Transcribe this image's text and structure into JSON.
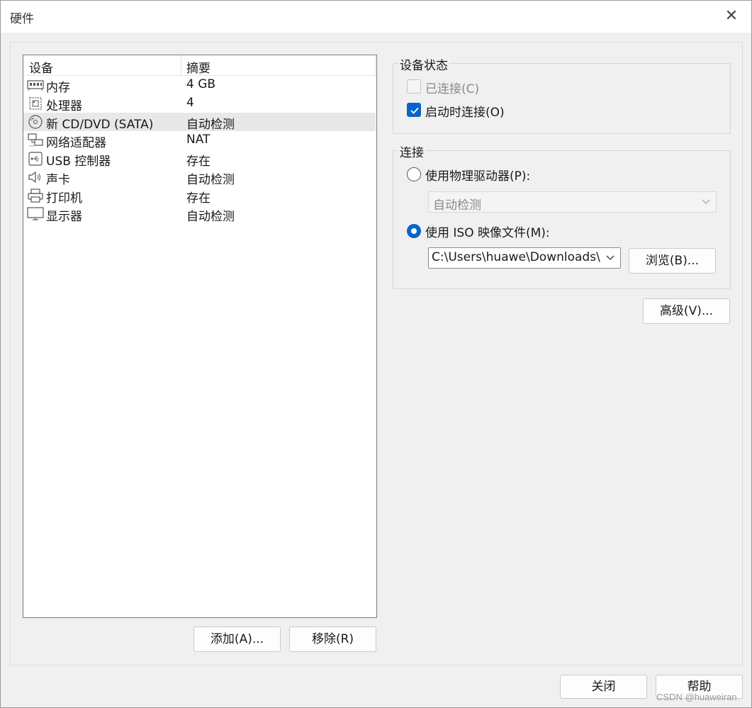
{
  "window": {
    "title": "硬件",
    "close_glyph": "✕"
  },
  "device_list": {
    "headers": {
      "device": "设备",
      "summary": "摘要"
    },
    "rows": [
      {
        "icon": "memory-icon",
        "name": "内存",
        "summary": "4 GB",
        "selected": false
      },
      {
        "icon": "processor-icon",
        "name": "处理器",
        "summary": "4",
        "selected": false
      },
      {
        "icon": "cd-dvd-icon",
        "name": "新 CD/DVD (SATA)",
        "summary": "自动检测",
        "selected": true
      },
      {
        "icon": "network-adapter-icon",
        "name": "网络适配器",
        "summary": "NAT",
        "selected": false
      },
      {
        "icon": "usb-icon",
        "name": "USB 控制器",
        "summary": "存在",
        "selected": false
      },
      {
        "icon": "sound-card-icon",
        "name": "声卡",
        "summary": "自动检测",
        "selected": false
      },
      {
        "icon": "printer-icon",
        "name": "打印机",
        "summary": "存在",
        "selected": false
      },
      {
        "icon": "display-icon",
        "name": "显示器",
        "summary": "自动检测",
        "selected": false
      }
    ],
    "add_button": "添加(A)...",
    "remove_button": "移除(R)"
  },
  "device_status": {
    "title": "设备状态",
    "connected_label": "已连接(C)",
    "connected_checked": false,
    "connected_enabled": false,
    "connect_at_power_on_label": "启动时连接(O)",
    "connect_at_power_on_checked": true
  },
  "connection": {
    "title": "连接",
    "physical_drive_label": "使用物理驱动器(P):",
    "physical_drive_selected": false,
    "physical_drive_value": "自动检测",
    "iso_label": "使用 ISO 映像文件(M):",
    "iso_selected": true,
    "iso_path": "C:\\Users\\huawe\\Downloads\\W",
    "browse_button": "浏览(B)..."
  },
  "advanced_button": "高级(V)...",
  "footer": {
    "close_button": "关闭",
    "help_button": "帮助"
  },
  "watermark": "CSDN @huaweiran",
  "colors": {
    "accent": "#0a64c8",
    "window_bg": "#f0f0f0",
    "selected_row": "#e8e8e8"
  }
}
